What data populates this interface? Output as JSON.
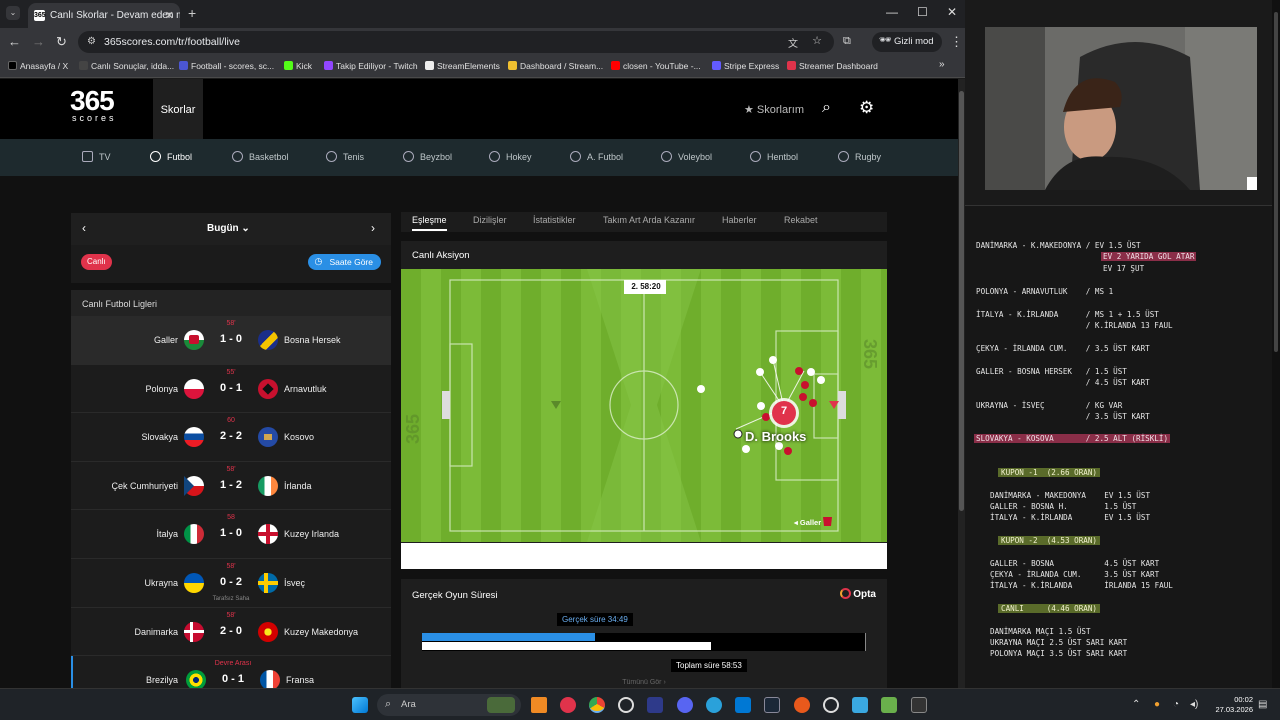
{
  "browser": {
    "tab_title": "Canlı Skorlar - Devam eden ma",
    "tab_favicon": "365",
    "url": "365scores.com/tr/football/live",
    "incognito_label": "Gizli mod",
    "bookmarks": [
      {
        "label": "Anasayfa / X",
        "color": "#000000"
      },
      {
        "label": "Canlı Sonuçlar, idda...",
        "color": "#1e1e1e"
      },
      {
        "label": "Football - scores, sc...",
        "color": "#4b56d2"
      },
      {
        "label": "Kick",
        "color": "#53fc18"
      },
      {
        "label": "Takip Ediliyor - Twitch",
        "color": "#9146ff"
      },
      {
        "label": "StreamElements",
        "color": "#ffffff"
      },
      {
        "label": "Dashboard / Stream...",
        "color": "#f0c030"
      },
      {
        "label": "closen - YouTube -...",
        "color": "#ff0000"
      },
      {
        "label": "Stripe Express",
        "color": "#635bff"
      },
      {
        "label": "Streamer Dashboard",
        "color": "#e0334b"
      }
    ]
  },
  "site": {
    "logo_main": "365",
    "logo_sub": "scores",
    "header_tab": "Skorlar",
    "favorites_label": "Skorlarım",
    "sports": [
      {
        "label": "TV",
        "active": false
      },
      {
        "label": "Futbol",
        "active": true
      },
      {
        "label": "Basketbol",
        "active": false
      },
      {
        "label": "Tenis",
        "active": false
      },
      {
        "label": "Beyzbol",
        "active": false
      },
      {
        "label": "Hokey",
        "active": false
      },
      {
        "label": "A. Futbol",
        "active": false
      },
      {
        "label": "Voleybol",
        "active": false
      },
      {
        "label": "Hentbol",
        "active": false
      },
      {
        "label": "Rugby",
        "active": false
      }
    ]
  },
  "left": {
    "date_label": "Bugün",
    "live_button": "Canlı",
    "time_sort_button": "Saate Göre",
    "league_heading": "Canlı Futbol Ligleri",
    "matches": [
      {
        "minute": "58'",
        "home": "Galler",
        "score": "1 - 0",
        "away": "Bosna Hersek",
        "note": ""
      },
      {
        "minute": "55'",
        "home": "Polonya",
        "score": "0 - 1",
        "away": "Arnavutluk",
        "note": ""
      },
      {
        "minute": "60",
        "home": "Slovakya",
        "score": "2 - 2",
        "away": "Kosovo",
        "note": ""
      },
      {
        "minute": "58'",
        "home": "Çek Cumhuriyeti",
        "score": "1 - 2",
        "away": "İrlanda",
        "note": ""
      },
      {
        "minute": "58",
        "home": "İtalya",
        "score": "1 - 0",
        "away": "Kuzey Irlanda",
        "note": ""
      },
      {
        "minute": "58'",
        "home": "Ukrayna",
        "score": "0 - 2",
        "away": "İsveç",
        "note": "Tarafsız Saha"
      },
      {
        "minute": "58'",
        "home": "Danimarka",
        "score": "2 - 0",
        "away": "Kuzey Makedonya",
        "note": ""
      },
      {
        "minute": "Devre Arası",
        "home": "Brezilya",
        "score": "0 - 1",
        "away": "Fransa",
        "note": ""
      }
    ]
  },
  "right": {
    "tabs": [
      "Eşleşme",
      "Dizilişler",
      "İstatistikler",
      "Takım Art Arda Kazanır",
      "Haberler",
      "Rekabet"
    ],
    "live_action_title": "Canlı Aksiyon",
    "period": "2.",
    "clock": "58:20",
    "player_number": "7",
    "player_name": "D. Brooks",
    "team_label": "Galler",
    "real_time_title": "Gerçek Oyun Süresi",
    "opta_label": "Opta",
    "real_time_label": "Gerçek süre 34:49",
    "total_time_label": "Toplam süre 58:53",
    "real_fraction": 0.39,
    "total_fraction": 0.652,
    "more_label": "Tümünü Gör"
  },
  "notes": {
    "lines": [
      {
        "text": "DANİMARKA - K.MAKEDONYA / EV 1.5 ÜST",
        "style": ""
      },
      {
        "text": "EV 2 YARIDA GOL ATAR",
        "style": "hl",
        "indent": true
      },
      {
        "text": "EV 17 ŞUT",
        "style": "",
        "indent": true
      },
      {
        "text": "POLONYA - ARNAVUTLUK    / MS 1",
        "style": ""
      },
      {
        "text": "İTALYA - K.İRLANDA      / MS 1 + 1.5 ÜST",
        "style": ""
      },
      {
        "text": "                        / K.İRLANDA 13 FAUL",
        "style": ""
      },
      {
        "text": "ÇEKYA - İRLANDA CUM.    / 3.5 ÜST KART",
        "style": ""
      },
      {
        "text": "GALLER - BOSNA HERSEK   / 1.5 ÜST",
        "style": ""
      },
      {
        "text": "                        / 4.5 ÜST KART",
        "style": ""
      },
      {
        "text": "UKRAYNA - İSVEÇ         / KG VAR",
        "style": ""
      },
      {
        "text": "                        / 3.5 ÜST KART",
        "style": ""
      },
      {
        "text": "SLOVAKYA - KOSOVA       / 2.5 ALT (RİSKLİ)",
        "style": "hl"
      },
      {
        "text": "KUPON -1  (2.66 ORAN)",
        "style": "kupon"
      },
      {
        "text": "DANİMARKA - MAKEDONYA    EV 1.5 ÜST",
        "style": ""
      },
      {
        "text": "GALLER - BOSNA H.        1.5 ÜST",
        "style": ""
      },
      {
        "text": "İTALYA - K.İRLANDA       EV 1.5 ÜST",
        "style": ""
      },
      {
        "text": "KUPON -2  (4.53 ORAN)",
        "style": "kupon"
      },
      {
        "text": "GALLER - BOSNA           4.5 ÜST KART",
        "style": ""
      },
      {
        "text": "ÇEKYA - İRLANDA CUM.     3.5 ÜST KART",
        "style": ""
      },
      {
        "text": "İTALYA - K.İRLANDA       İRLANDA 15 FAUL",
        "style": ""
      },
      {
        "text": "CANLI     (4.46 ORAN)",
        "style": "kupon"
      },
      {
        "text": "DANİMARKA MAÇI 1.5 ÜST",
        "style": ""
      },
      {
        "text": "UKRAYNA MAÇI 2.5 ÜST SARI KART",
        "style": ""
      },
      {
        "text": "POLONYA MAÇI 3.5 ÜST SARI KART",
        "style": ""
      }
    ]
  },
  "taskbar": {
    "search_label": "Ara",
    "time": "00:02",
    "date": "27.03.2026"
  }
}
